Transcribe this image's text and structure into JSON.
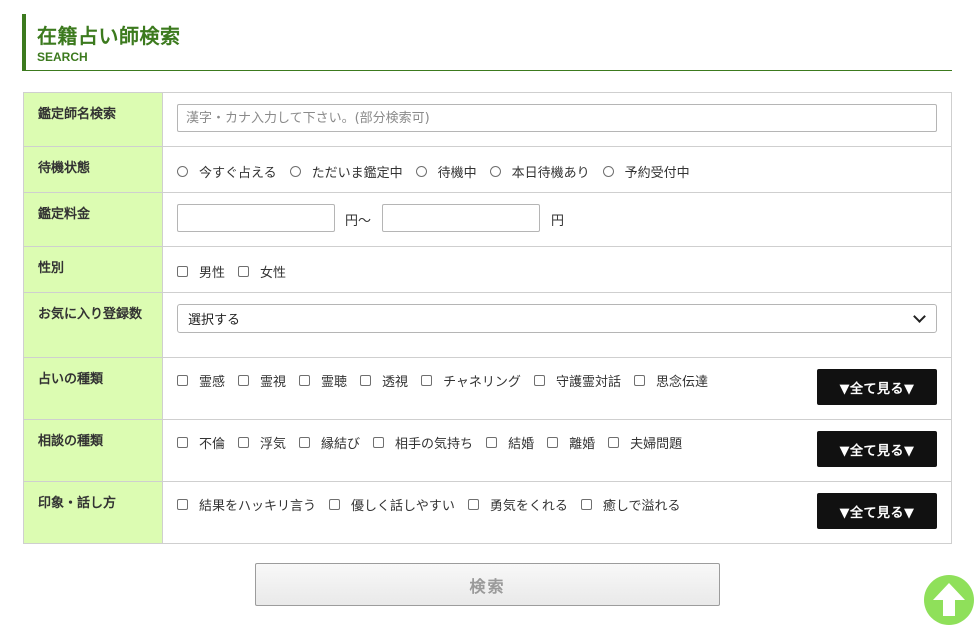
{
  "heading": {
    "title": "在籍占い師検索",
    "subtitle": "SEARCH"
  },
  "form": {
    "name_search": {
      "label": "鑑定師名検索",
      "placeholder": "漢字・カナ入力して下さい。(部分検索可)"
    },
    "status": {
      "label": "待機状態",
      "options": [
        "今すぐ占える",
        "ただいま鑑定中",
        "待機中",
        "本日待機あり",
        "予約受付中"
      ]
    },
    "fee": {
      "label": "鑑定料金",
      "unit_from": "円～",
      "unit_to": "円"
    },
    "gender": {
      "label": "性別",
      "options": [
        "男性",
        "女性"
      ]
    },
    "favorites": {
      "label": "お気に入り登録数",
      "selected": "選択する"
    },
    "divination_type": {
      "label": "占いの種類",
      "options": [
        "霊感",
        "霊視",
        "霊聴",
        "透視",
        "チャネリング",
        "守護霊対話",
        "思念伝達"
      ],
      "see_all": "▼全て見る▼"
    },
    "consult_type": {
      "label": "相談の種類",
      "options": [
        "不倫",
        "浮気",
        "縁結び",
        "相手の気持ち",
        "結婚",
        "離婚",
        "夫婦問題"
      ],
      "see_all": "▼全て見る▼"
    },
    "impression": {
      "label": "印象・話し方",
      "options": [
        "結果をハッキリ言う",
        "優しく話しやすい",
        "勇気をくれる",
        "癒しで溢れる"
      ],
      "see_all": "▼全て見る▼"
    }
  },
  "search_button": "検索",
  "colors": {
    "accent": "#3c7a1e",
    "label_bg": "#dcfcb2",
    "scroll_top": "#8fe05a"
  },
  "icons": {
    "scroll_top": "arrow-up-icon"
  }
}
